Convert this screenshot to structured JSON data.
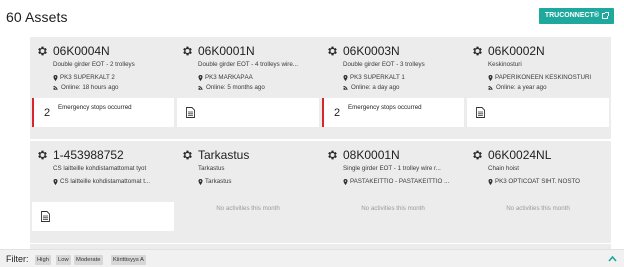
{
  "header": {
    "title": "60 Assets",
    "connect_button": "TRUCONNECT®",
    "accent_color": "#1fa89d"
  },
  "cards": [
    {
      "title": "06K0004N",
      "description": "Double girder EOT - 2 trolleys",
      "location": "PK3 SUPERKALT 2",
      "online": "Online: 18 hours ago",
      "activity": {
        "type": "alert",
        "count": "2",
        "text": "Emergency stops occurred"
      }
    },
    {
      "title": "06K0001N",
      "description": "Double girder EOT - 4 trolleys wire...",
      "location": "PK3 MÄRKÄPÄÄ",
      "online": "Online: 5 months ago",
      "activity": {
        "type": "document"
      }
    },
    {
      "title": "06K0003N",
      "description": "Double girder EOT - 3 trolleys",
      "location": "PK3 SUPERKALT 1",
      "online": "Online: a day ago",
      "activity": {
        "type": "alert",
        "count": "2",
        "text": "Emergency stops occurred"
      }
    },
    {
      "title": "06K0002N",
      "description": "Keskinosturi",
      "location": "PAPERIKONEEN KESKINOSTURI",
      "online": "Online: a year ago",
      "activity": {
        "type": "document"
      }
    },
    {
      "title": "1-453988752",
      "description": "CS laitteille kohdistamattomat tyot",
      "location": "CS laitteille kohdistamattomat t...",
      "online": "",
      "activity": {
        "type": "document"
      }
    },
    {
      "title": "Tarkastus",
      "description": "Tarkastus",
      "location": "Tarkastus",
      "online": "",
      "activity": {
        "type": "none",
        "text": "No activities this month"
      }
    },
    {
      "title": "08K0001N",
      "description": "Single girder EOT - 1 trolley wire r...",
      "location": "PASTAKEITTIO - PASTAKEITTIO ...",
      "online": "",
      "activity": {
        "type": "none",
        "text": "No activities this month"
      }
    },
    {
      "title": "06K0024NL",
      "description": "Chain hoist",
      "location": "PK3 OPTICOAT SIHT. NOSTO",
      "online": "",
      "activity": {
        "type": "none",
        "text": "No activities this month"
      }
    }
  ],
  "filter": {
    "label": "Filter:",
    "chips": [
      "High",
      "Low",
      "Moderate",
      "Kiirittisyys A"
    ]
  },
  "colors": {
    "alert": "#d9262b",
    "card_background": "#ececec"
  }
}
